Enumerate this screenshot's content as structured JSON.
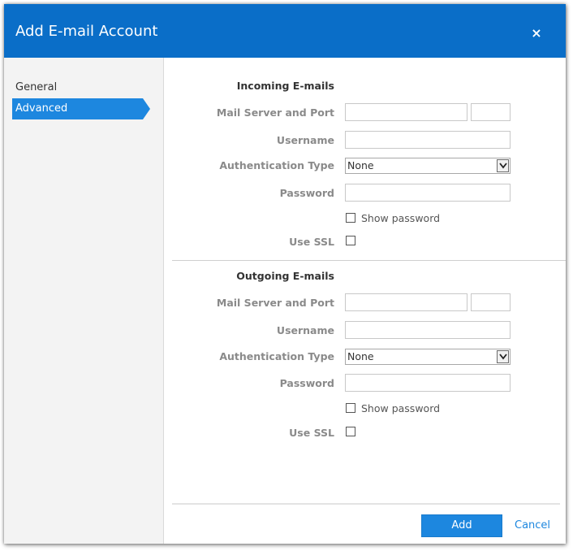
{
  "dialog": {
    "title": "Add E-mail Account",
    "close_label": "×"
  },
  "sidebar": {
    "items": [
      {
        "label": "General",
        "selected": false
      },
      {
        "label": "Advanced",
        "selected": true
      }
    ]
  },
  "incoming": {
    "section_title": "Incoming E-mails",
    "server_label": "Mail Server and Port",
    "server_value": "",
    "port_value": "",
    "username_label": "Username",
    "username_value": "",
    "auth_label": "Authentication Type",
    "auth_value": "None",
    "password_label": "Password",
    "password_value": "",
    "show_password_label": "Show password",
    "show_password_checked": false,
    "ssl_label": "Use SSL",
    "ssl_checked": false
  },
  "outgoing": {
    "section_title": "Outgoing E-mails",
    "server_label": "Mail Server and Port",
    "server_value": "",
    "port_value": "",
    "username_label": "Username",
    "username_value": "",
    "auth_label": "Authentication Type",
    "auth_value": "None",
    "password_label": "Password",
    "password_value": "",
    "show_password_label": "Show password",
    "show_password_checked": false,
    "ssl_label": "Use SSL",
    "ssl_checked": false
  },
  "footer": {
    "add_label": "Add",
    "cancel_label": "Cancel"
  },
  "colors": {
    "header": "#0a6ec8",
    "accent": "#1d87df",
    "sidebar_bg": "#f3f3f3"
  }
}
